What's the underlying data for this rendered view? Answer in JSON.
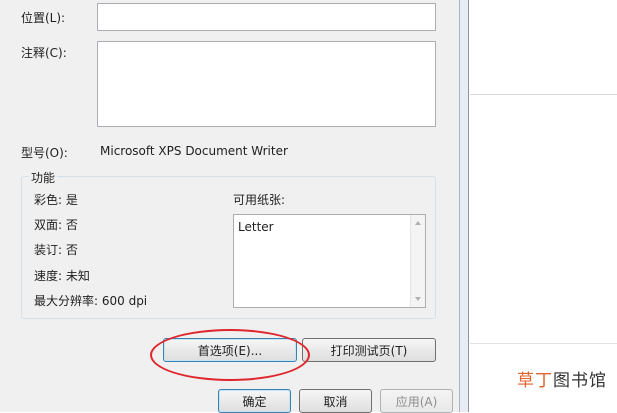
{
  "form": {
    "location_label": "位置(L):",
    "location_value": "",
    "comment_label": "注释(C):",
    "comment_value": "",
    "model_label": "型号(O):",
    "model_value": "Microsoft XPS Document Writer"
  },
  "features": {
    "title": "功能",
    "color": "彩色: 是",
    "duplex": "双面: 否",
    "staple": "装订: 否",
    "speed": "速度: 未知",
    "max_resolution": "最大分辨率: 600 dpi",
    "paper_label": "可用纸张:",
    "paper_items": [
      "Letter"
    ]
  },
  "buttons": {
    "preferences": "首选项(E)...",
    "print_test_page": "打印测试页(T)",
    "ok": "确定",
    "cancel": "取消",
    "apply": "应用(A)"
  },
  "watermark": {
    "accent": "草丁",
    "rest": "图书馆"
  },
  "colors": {
    "annotation_oval": "#e0262d",
    "watermark_accent": "#e0622c"
  }
}
